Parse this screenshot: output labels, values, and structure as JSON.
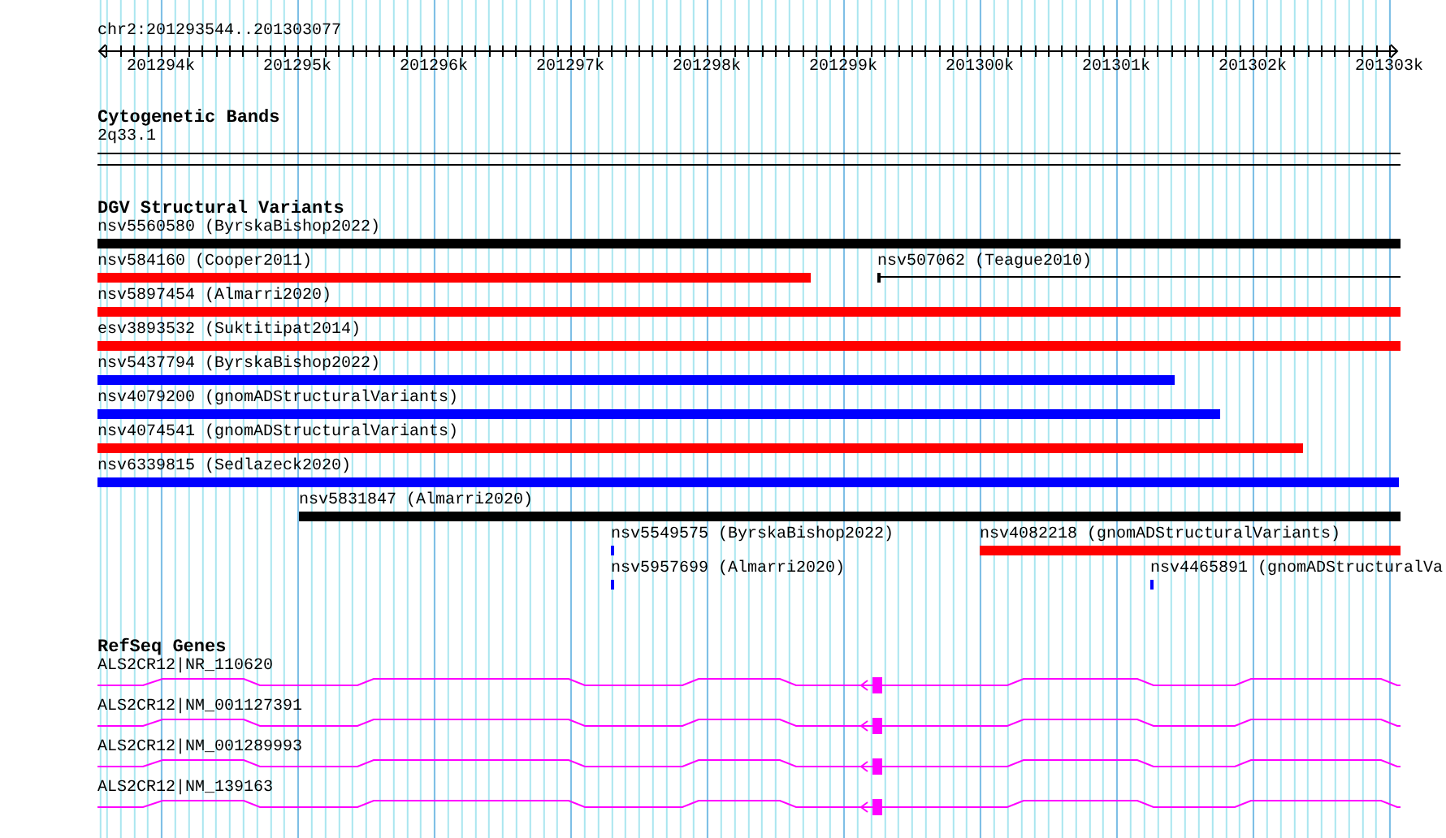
{
  "ruler": {
    "title": "chr2:201293544..201303077",
    "ticks": [
      "201294k",
      "201295k",
      "201296k",
      "201297k",
      "201298k",
      "201299k",
      "201300k",
      "201301k",
      "201302k",
      "201303k"
    ]
  },
  "cytogenetic_bands": {
    "title": "Cytogenetic Bands",
    "band": "2q33.1"
  },
  "dgv_structural_variants": {
    "title": "DGV Structural Variants",
    "rows": [
      {
        "features": [
          {
            "label": "nsv5560580 (ByrskaBishop2022)",
            "color": "#000000",
            "kind": "bar"
          }
        ]
      },
      {
        "features": [
          {
            "label": "nsv584160 (Cooper2011)",
            "color": "#ff0000",
            "kind": "bar"
          },
          {
            "label": "nsv507062 (Teague2010)",
            "color": "#000000",
            "kind": "line"
          }
        ]
      },
      {
        "features": [
          {
            "label": "nsv5897454 (Almarri2020)",
            "color": "#ff0000",
            "kind": "bar"
          }
        ]
      },
      {
        "features": [
          {
            "label": "esv3893532 (Suktitipat2014)",
            "color": "#ff0000",
            "kind": "bar"
          }
        ]
      },
      {
        "features": [
          {
            "label": "nsv5437794 (ByrskaBishop2022)",
            "color": "#0000ff",
            "kind": "bar"
          }
        ]
      },
      {
        "features": [
          {
            "label": "nsv4079200 (gnomADStructuralVariants)",
            "color": "#0000ff",
            "kind": "bar"
          }
        ]
      },
      {
        "features": [
          {
            "label": "nsv4074541 (gnomADStructuralVariants)",
            "color": "#ff0000",
            "kind": "bar"
          }
        ]
      },
      {
        "features": [
          {
            "label": "nsv6339815 (Sedlazeck2020)",
            "color": "#0000ff",
            "kind": "bar"
          }
        ]
      },
      {
        "features": [
          {
            "label": "nsv5831847 (Almarri2020)",
            "color": "#000000",
            "kind": "bar"
          }
        ]
      },
      {
        "features": [
          {
            "label": "nsv5549575 (ByrskaBishop2022)",
            "color": "#0000ff",
            "kind": "bar"
          },
          {
            "label": "nsv4082218 (gnomADStructuralVariants)",
            "color": "#ff0000",
            "kind": "bar"
          }
        ]
      },
      {
        "features": [
          {
            "label": "nsv5957699 (Almarri2020)",
            "color": "#0000ff",
            "kind": "bar"
          },
          {
            "label": "nsv4465891 (gnomADStructuralVa",
            "color": "#0000ff",
            "kind": "bar"
          }
        ]
      }
    ]
  },
  "refseq_genes": {
    "title": "RefSeq Genes",
    "transcripts": [
      {
        "label": "ALS2CR12|NR_110620"
      },
      {
        "label": "ALS2CR12|NM_001127391"
      },
      {
        "label": "ALS2CR12|NM_001289993"
      },
      {
        "label": "ALS2CR12|NM_139163"
      }
    ]
  }
}
